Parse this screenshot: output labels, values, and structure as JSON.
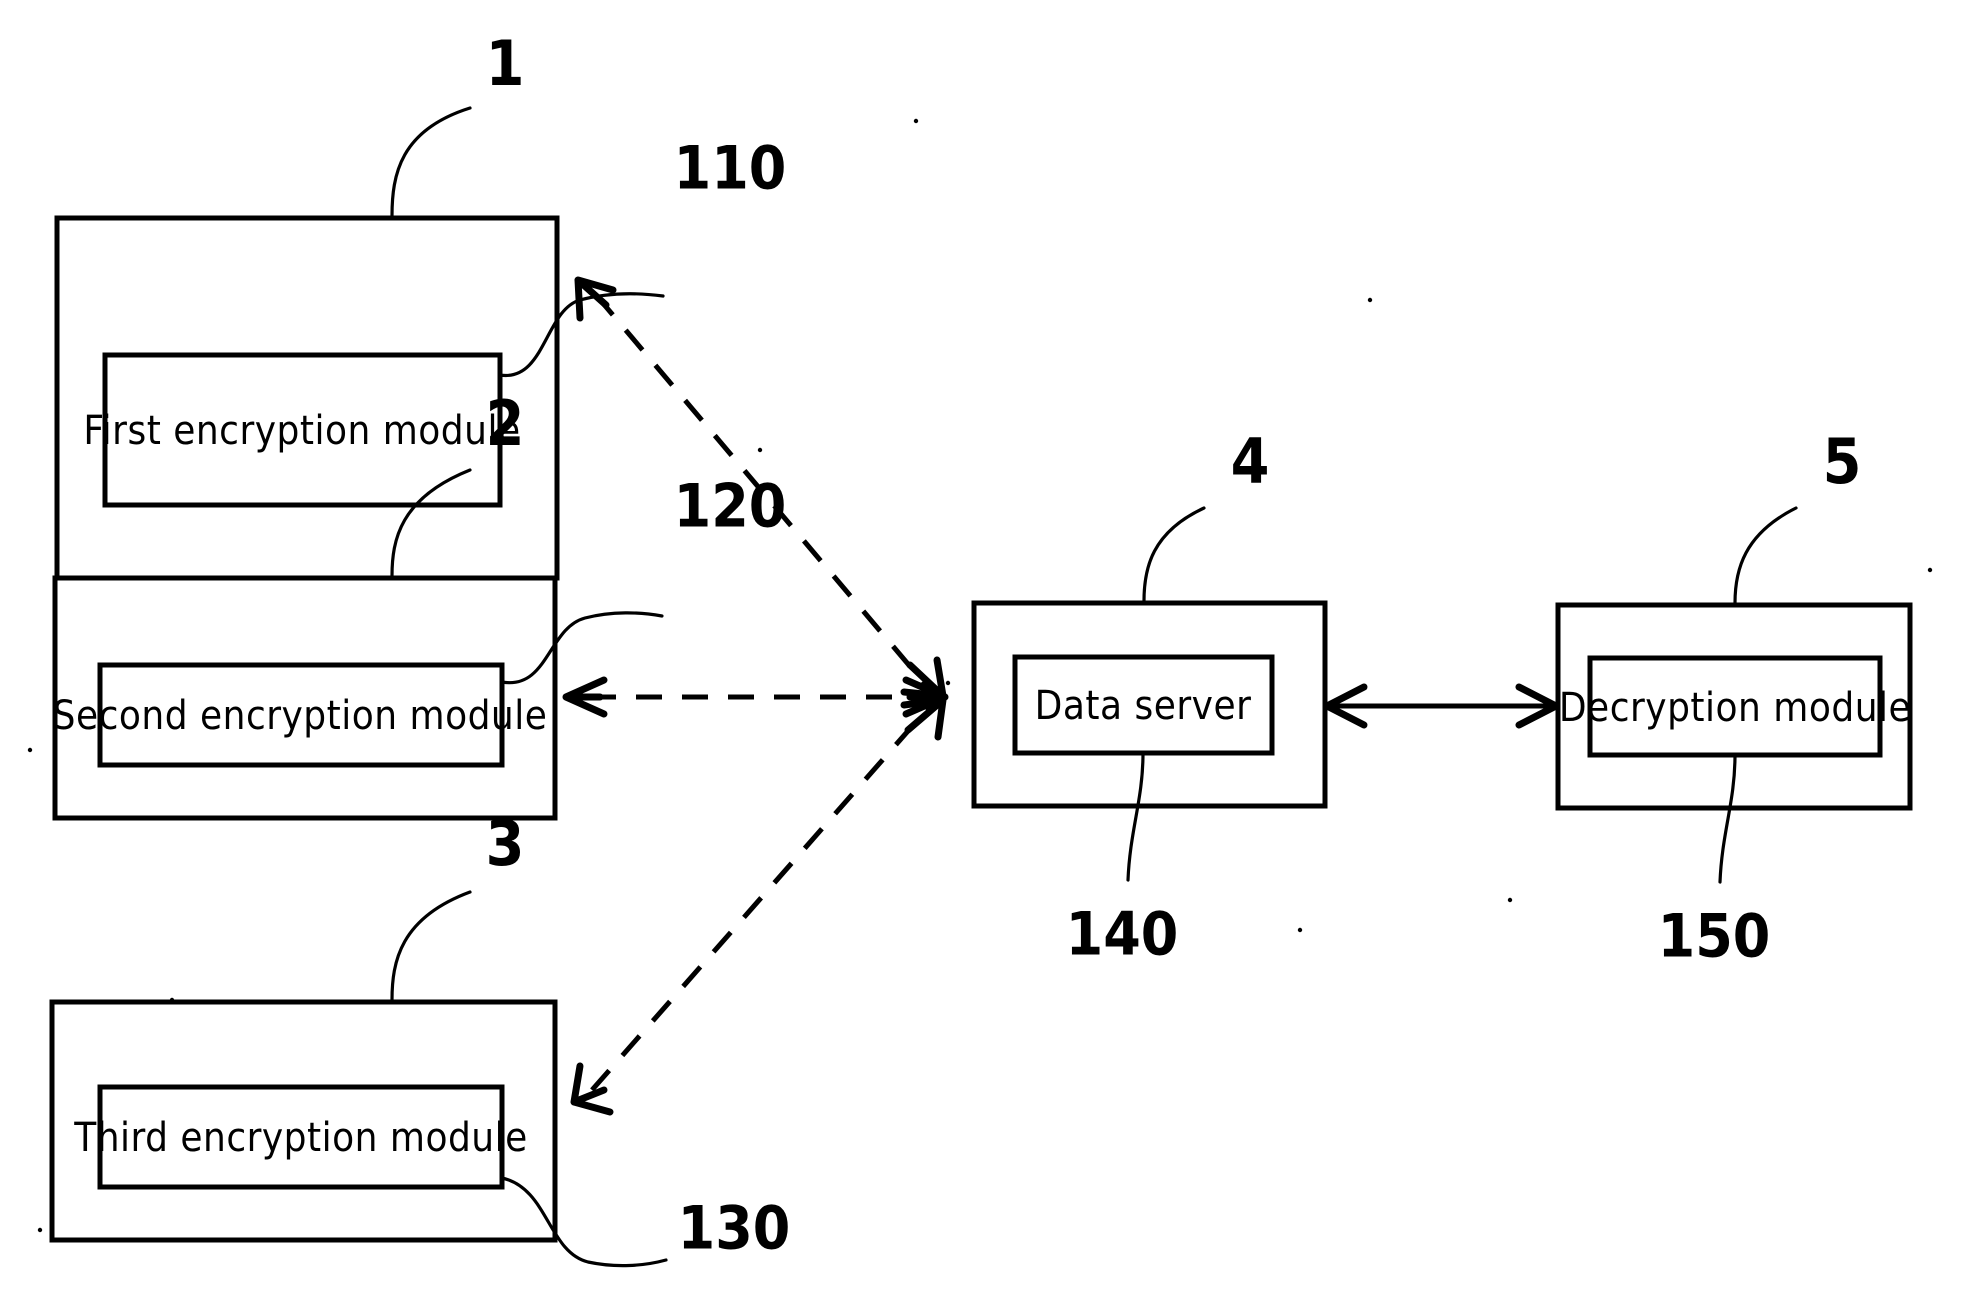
{
  "figure": {
    "type": "patent-block-diagram",
    "background_color": "#ffffff",
    "line_color": "#000000"
  },
  "blocks": [
    {
      "id": "first-encryption-unit",
      "outer_ref": "1",
      "inner_ref": "110",
      "inner_label": "First encryption module"
    },
    {
      "id": "second-encryption-unit",
      "outer_ref": "2",
      "inner_ref": "120",
      "inner_label": "Second encryption module"
    },
    {
      "id": "third-encryption-unit",
      "outer_ref": "3",
      "inner_ref": "130",
      "inner_label": "Third encryption module"
    },
    {
      "id": "data-server-unit",
      "outer_ref": "4",
      "inner_ref": "140",
      "inner_label": "Data server"
    },
    {
      "id": "decryption-unit",
      "outer_ref": "5",
      "inner_ref": "150",
      "inner_label": "Decryption module"
    }
  ],
  "connections": [
    {
      "id": "first-to-server",
      "style": "dashed",
      "direction": "bidirectional",
      "from": "first-encryption-unit",
      "to": "data-server-unit"
    },
    {
      "id": "second-to-server",
      "style": "dashed",
      "direction": "bidirectional",
      "from": "second-encryption-unit",
      "to": "data-server-unit"
    },
    {
      "id": "third-to-server",
      "style": "dashed",
      "direction": "bidirectional",
      "from": "third-encryption-unit",
      "to": "data-server-unit"
    },
    {
      "id": "server-to-decryption",
      "style": "solid",
      "direction": "bidirectional",
      "from": "data-server-unit",
      "to": "decryption-unit"
    }
  ]
}
